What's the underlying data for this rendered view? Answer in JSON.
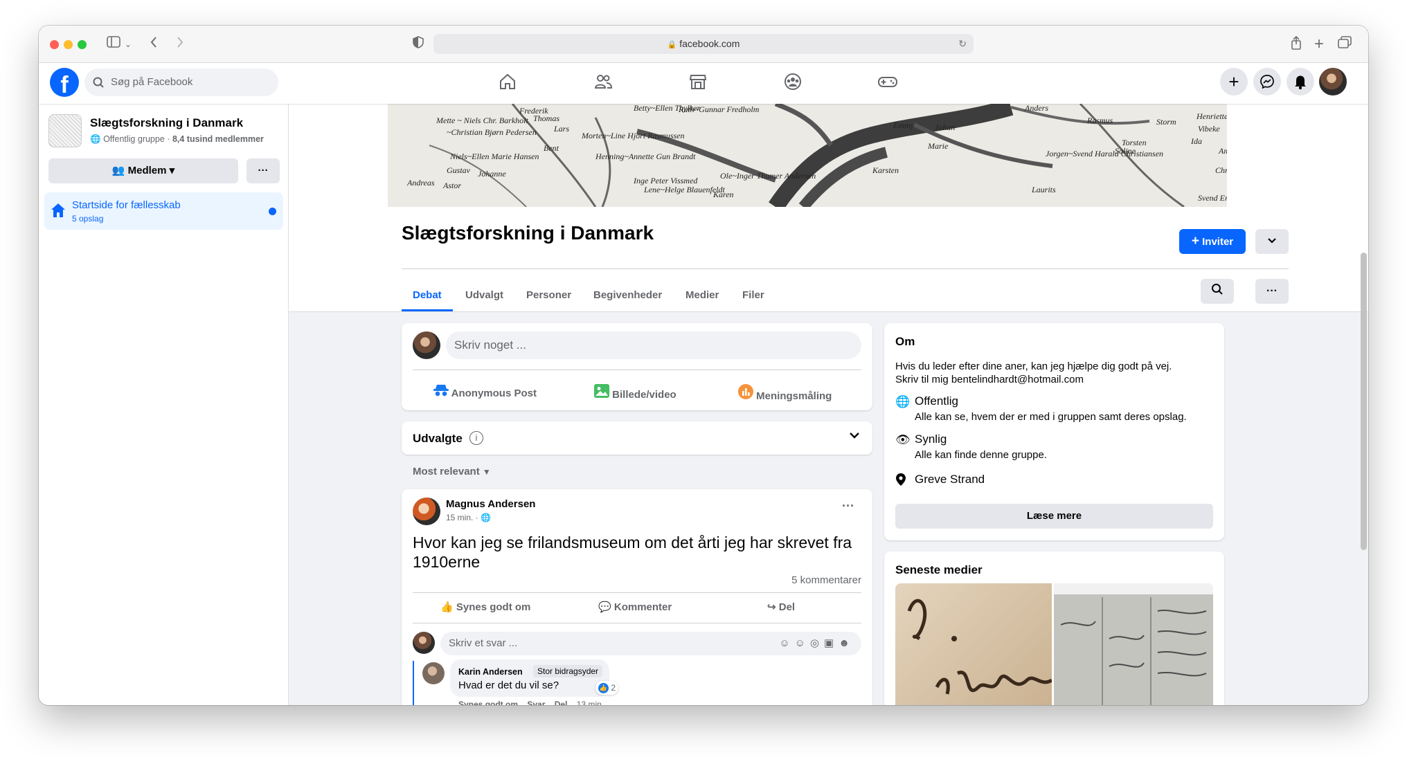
{
  "browser": {
    "url": "facebook.com",
    "colors": {
      "close": "#ff5f57",
      "minimize": "#febc2e",
      "zoom": "#28c840"
    }
  },
  "topbar": {
    "search_placeholder": "Søg på Facebook",
    "nav_icons": [
      "home-icon",
      "friends-icon",
      "marketplace-icon",
      "groups-icon",
      "gaming-icon"
    ],
    "right_icons": [
      "create-icon",
      "messenger-icon",
      "notifications-icon",
      "account-avatar"
    ]
  },
  "sidebar": {
    "group_name": "Slægtsforskning i Danmark",
    "group_privacy": "Offentlig gruppe",
    "separator": "·",
    "member_count": "8,4 tusind medlemmer",
    "member_button": "Medlem",
    "more_button": "···",
    "nav_item": {
      "label": "Startside for fællesskab",
      "sub": "5 opslag"
    }
  },
  "header": {
    "title": "Slægtsforskning i Danmark",
    "invite_button": "Inviter",
    "tabs": [
      "Debat",
      "Udvalgt",
      "Personer",
      "Begivenheder",
      "Medier",
      "Filer"
    ],
    "active_tab": "Debat"
  },
  "composer": {
    "placeholder": "Skriv noget ...",
    "actions": [
      "Anonymous Post",
      "Billede/video",
      "Meningsmåling"
    ]
  },
  "featured": {
    "label": "Udvalgte",
    "sort_label": "Most relevant"
  },
  "post": {
    "author": "Magnus Andersen",
    "time": "15 min. ·",
    "text": "Hvor kan jeg se frilandsmuseum om det årti jeg har skrevet fra 1910erne",
    "comment_count": "5 kommentarer",
    "actions": [
      "Synes godt om",
      "Kommenter",
      "Del"
    ],
    "reply_placeholder": "Skriv et svar ...",
    "comment": {
      "author": "Karin Andersen",
      "badge": "Stor bidragsyder",
      "text": "Hvad er det du vil se?",
      "reactions": "2",
      "actions": [
        "Synes godt om",
        "Svar",
        "Del"
      ],
      "time": "13 min"
    }
  },
  "about": {
    "title": "Om",
    "description_line1": "Hvis du leder efter dine aner, kan jeg hjælpe dig godt på vej.",
    "description_line2": "Skriv til mig bentelindhardt@hotmail.com",
    "public_title": "Offentlig",
    "public_desc": "Alle kan se, hvem der er med i gruppen samt deres opslag.",
    "visible_title": "Synlig",
    "visible_desc": "Alle kan finde denne gruppe.",
    "location": "Greve Strand",
    "read_more": "Læse mere"
  },
  "media": {
    "title": "Seneste medier"
  },
  "cover_text": [
    "Mette ~ Niels Chr. Barkholt",
    "~Christian Bjørn Pedersen",
    "Niels~Ellen Marie Hansen",
    "Gustav",
    "Astor",
    "Andreas",
    "Johanne",
    "Frederik",
    "Thomas",
    "Lars",
    "Morten~Line Hjort Rasmussen",
    "Bent",
    "Henning~Annette Gun Brandt",
    "Inge Peter Vissmed",
    "Lene~Helge Blauenfeldt",
    "Ole~Inger Thumer Andersen",
    "Karen",
    "Ruth~Gunnar Fredholm",
    "Betty~Ellen Thylker",
    "Emmy",
    "Johan",
    "Marie",
    "Anders",
    "Rasmus",
    "Torsten",
    "Saline",
    "Storm",
    "Henriette",
    "Vibeke",
    "Ida",
    "Amanda",
    "Christina~Bente Andersen",
    "Svend Erik~Ella Sundgaard",
    "Jorgen~Svend Harald Christiansen",
    "Laurits",
    "Karsten"
  ]
}
